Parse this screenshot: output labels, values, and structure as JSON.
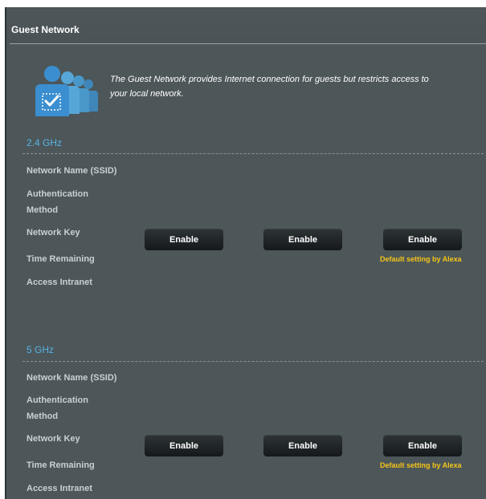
{
  "header": {
    "title": "Guest Network"
  },
  "intro": {
    "icon": "guest-users-icon",
    "description": "The Guest Network provides Internet connection for guests but restricts access to your local network."
  },
  "bands": [
    {
      "title": "2.4 GHz",
      "labels": [
        "Network Name (SSID)",
        "Authentication Method",
        "Network Key",
        "Time Remaining",
        "Access Intranet"
      ],
      "buttons": [
        "Enable",
        "Enable",
        "Enable"
      ],
      "note": "Default setting by Alexa"
    },
    {
      "title": "5 GHz",
      "labels": [
        "Network Name (SSID)",
        "Authentication Method",
        "Network Key",
        "Time Remaining",
        "Access Intranet"
      ],
      "buttons": [
        "Enable",
        "Enable",
        "Enable"
      ],
      "note": "Default setting by Alexa"
    }
  ],
  "colors": {
    "panel": "#4d5659",
    "band_title": "#55b4e6",
    "note": "#f5c518",
    "button": "#1b2022"
  }
}
